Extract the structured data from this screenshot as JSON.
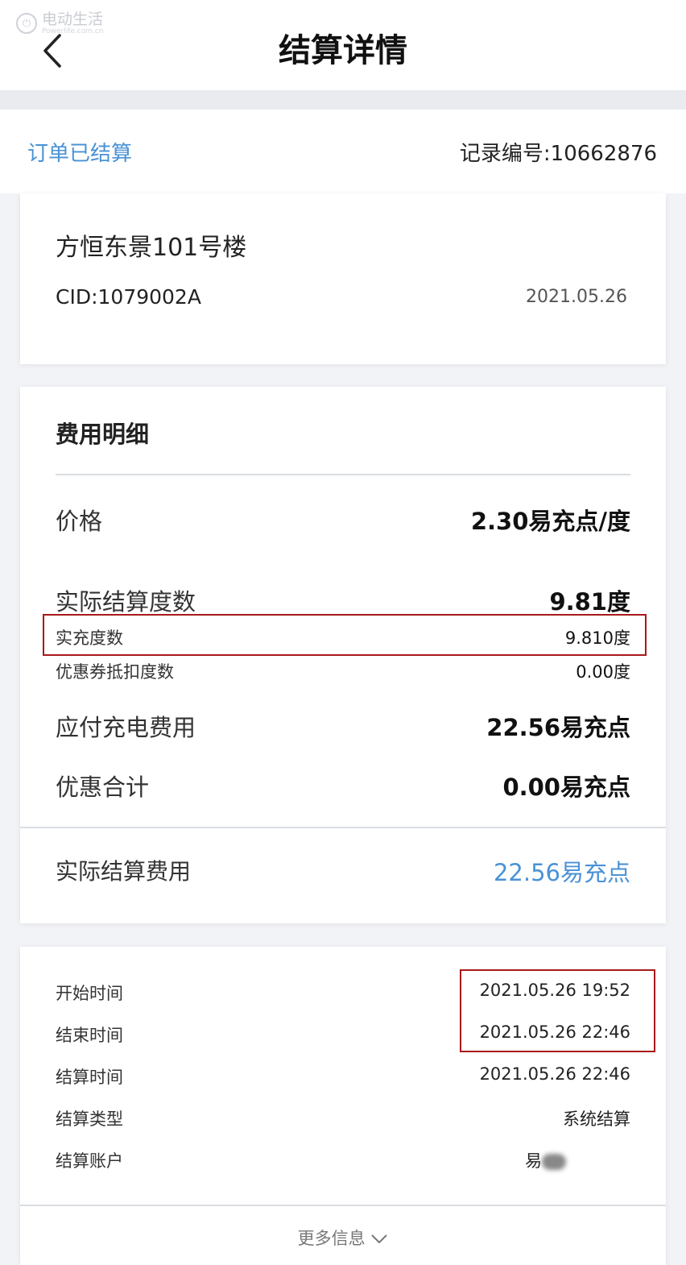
{
  "watermark": {
    "name": "电动生活",
    "sub": "Powerlife.com.cn"
  },
  "header": {
    "title": "结算详情"
  },
  "status": {
    "label": "订单已结算",
    "record": "记录编号:10662876"
  },
  "station": {
    "name": "方恒东景101号楼",
    "cid": "CID:1079002A",
    "date": "2021.05.26"
  },
  "fees": {
    "title": "费用明细",
    "rows": [
      {
        "label": "价格",
        "value": "2.30易充点/度"
      },
      {
        "label": "实际结算度数",
        "value": "9.81度"
      },
      {
        "label": "实充度数",
        "value": "9.810度"
      },
      {
        "label": "优惠券抵扣度数",
        "value": "0.00度"
      },
      {
        "label": "应付充电费用",
        "value": "22.56易充点"
      },
      {
        "label": "优惠合计",
        "value": "0.00易充点"
      }
    ],
    "actual": {
      "label": "实际结算费用",
      "value": "22.56易充点"
    }
  },
  "info": {
    "rows": [
      {
        "label": "开始时间",
        "value": "2021.05.26 19:52"
      },
      {
        "label": "结束时间",
        "value": "2021.05.26 22:46"
      },
      {
        "label": "结算时间",
        "value": "2021.05.26 22:46"
      },
      {
        "label": "结算类型",
        "value": "系统结算"
      },
      {
        "label": "结算账户",
        "value": "易"
      }
    ],
    "more": "更多信息"
  }
}
